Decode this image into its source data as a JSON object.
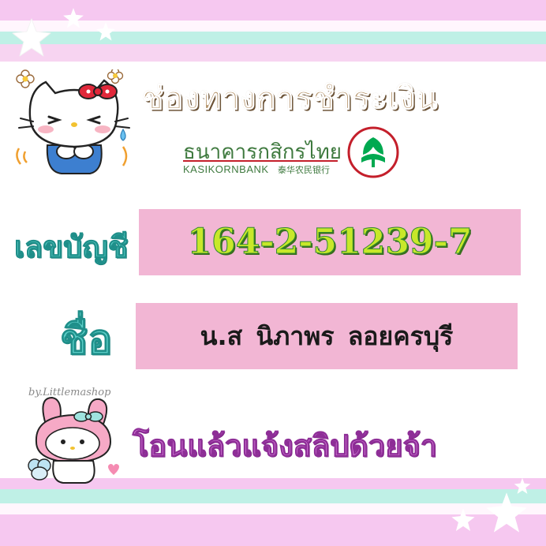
{
  "title": "ช่องทางการชำระเงิน",
  "bank": {
    "name_th": "ธนาคารกสิกรไทย",
    "name_en": "KASIKORNBANK",
    "name_cn": "泰华农民银行",
    "logo_icon": "kasikornbank-logo-icon",
    "brand_color": "#00a950",
    "accent_color": "#c41f2b"
  },
  "account": {
    "label": "เลขบัญชี",
    "number": "164-2-51239-7"
  },
  "name": {
    "label": "ชื่อ",
    "value": "น.ส นิภาพร ลอยครบุรี"
  },
  "credit": "by.Littlemashop",
  "footer": "โอนแล้วแจ้งสลิปด้วยจ้า",
  "colors": {
    "box_pink": "#f2b6d4",
    "stripe_pink": "#f6c8f0",
    "stripe_mint": "#bff0e6",
    "label_teal": "#5ccfc8",
    "number_green": "#c8e82a",
    "footer_purple": "#d47ad8",
    "title_tan": "#b4936a"
  }
}
